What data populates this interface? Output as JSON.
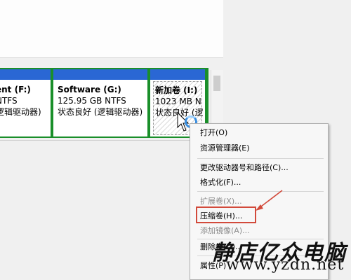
{
  "partitions": [
    {
      "name": "ent  (F:)",
      "size": "NTFS",
      "status": "逻辑驱动器)"
    },
    {
      "name": "Software  (G:)",
      "size": "125.95 GB NTFS",
      "status": "状态良好 (逻辑驱动器)"
    },
    {
      "name": "新加卷  (I:)",
      "size": "1023 MB N",
      "status": "状态良好 (逻"
    }
  ],
  "context_menu": {
    "items": [
      {
        "label": "打开(O)",
        "disabled": false
      },
      {
        "label": "资源管理器(E)",
        "disabled": false
      },
      {
        "label": "更改驱动器号和路径(C)...",
        "disabled": false
      },
      {
        "label": "格式化(F)...",
        "disabled": false
      },
      {
        "label": "扩展卷(X)...",
        "disabled": true
      },
      {
        "label": "压缩卷(H)...",
        "disabled": false,
        "highlighted": true
      },
      {
        "label": "添加镜像(A)...",
        "disabled": true
      },
      {
        "label": "删除卷(D)...",
        "disabled": false
      },
      {
        "label": "属性(P)",
        "disabled": false
      }
    ]
  },
  "watermark": {
    "chinese": "静店亿众电脑",
    "url": "www.yzdn.net"
  },
  "colors": {
    "partition_header": "#2a67d4",
    "selection_outline": "#1a8f2a",
    "annotation_red": "#d24a3b"
  }
}
